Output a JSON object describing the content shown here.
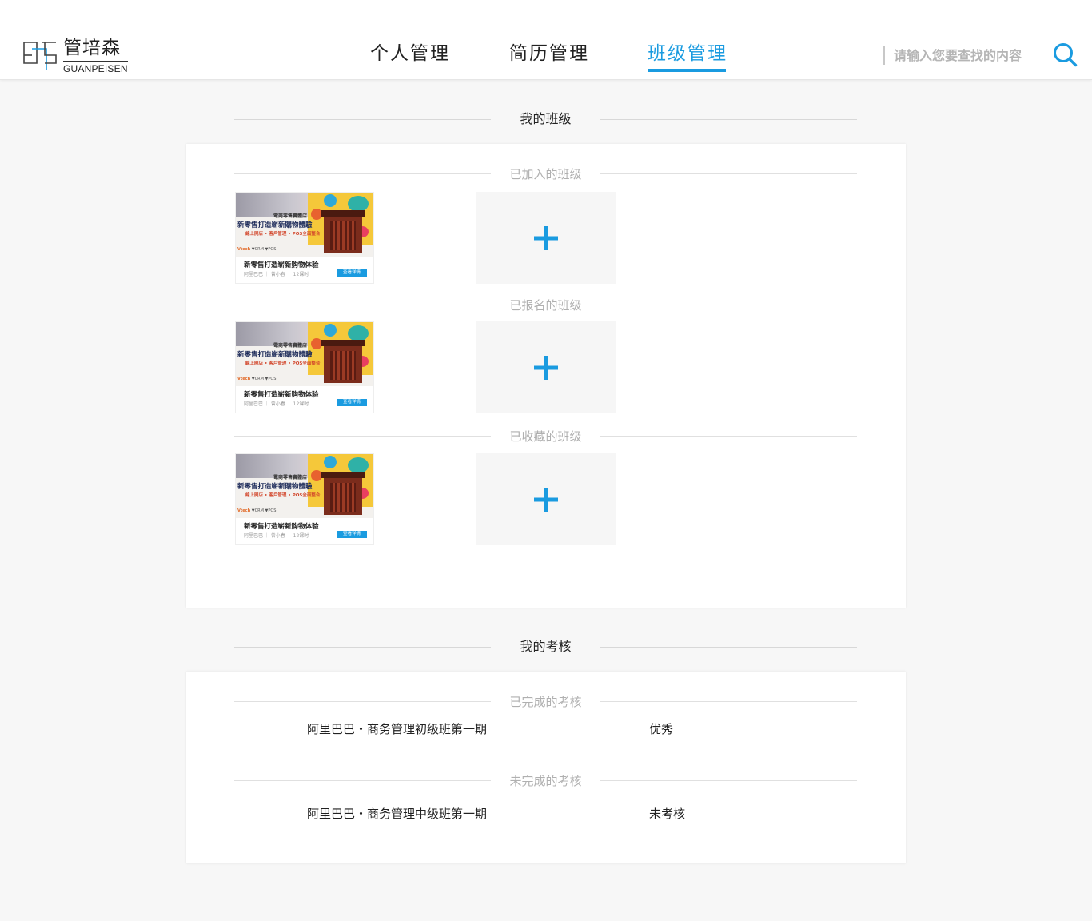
{
  "brand": {
    "name_cn": "管培森",
    "name_en": "GUANPEISEN",
    "logo_icon": "gps-logo-mark"
  },
  "nav": {
    "tabs": [
      {
        "label": "个人管理",
        "active": false
      },
      {
        "label": "简历管理",
        "active": false
      },
      {
        "label": "班级管理",
        "active": true
      }
    ]
  },
  "search": {
    "placeholder": "请输入您要查找的内容",
    "value": "",
    "icon": "search-icon"
  },
  "colors": {
    "accent": "#1a9be0",
    "page_bg": "#f7f7f7"
  },
  "classes": {
    "title": "我的班级",
    "groups": [
      {
        "label": "已加入的班级"
      },
      {
        "label": "已报名的班级"
      },
      {
        "label": "已收藏的班级"
      }
    ],
    "card": {
      "banner_top": "電商零售實體店",
      "banner_headline": "新零售打造嶄新購物體驗",
      "banner_sub": "線上開店 • 客戶管理 • POS全面整合",
      "banner_logos": [
        "Vtech",
        "CRM",
        "POS"
      ],
      "title": "新零售打造崭新购物体验",
      "meta": "阿里巴巴 ｜ 曾小春 ｜ 12课时",
      "button": "查看详情"
    },
    "add_icon": "plus-icon"
  },
  "exams": {
    "title": "我的考核",
    "completed": {
      "label": "已完成的考核",
      "items": [
        {
          "name": "阿里巴巴・商务管理初级班第一期",
          "result": "优秀"
        }
      ]
    },
    "pending": {
      "label": "未完成的考核",
      "items": [
        {
          "name": "阿里巴巴・商务管理中级班第一期",
          "result": "未考核"
        }
      ]
    }
  }
}
